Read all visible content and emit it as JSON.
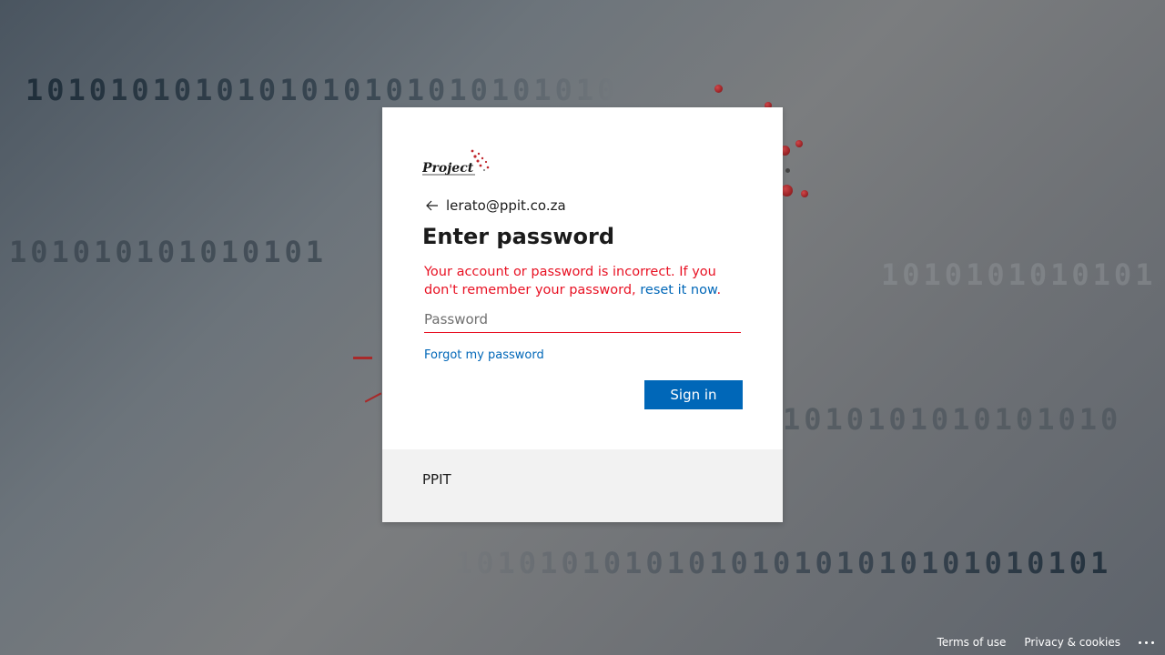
{
  "background": {
    "binary_rows": [
      "1010101010101010101010101010",
      "101010101010101",
      "1010101010101",
      "1010101010101010",
      "1010101010101010101010101010101"
    ]
  },
  "card": {
    "logo_text": "Project",
    "identity": "lerato@ppit.co.za",
    "title": "Enter password",
    "error_text": "Your account or password is incorrect. If you don't remember your password, ",
    "error_link": "reset it now",
    "error_end": ".",
    "password_placeholder": "Password",
    "password_value": "",
    "forgot_label": "Forgot my password",
    "signin_label": "Sign in",
    "org_name": "PPIT"
  },
  "footer": {
    "terms_label": "Terms of use",
    "privacy_label": "Privacy & cookies",
    "more_icon": "ellipsis-icon"
  },
  "colors": {
    "accent": "#0067b8",
    "error": "#e81123",
    "card_footer": "#f2f2f2"
  }
}
